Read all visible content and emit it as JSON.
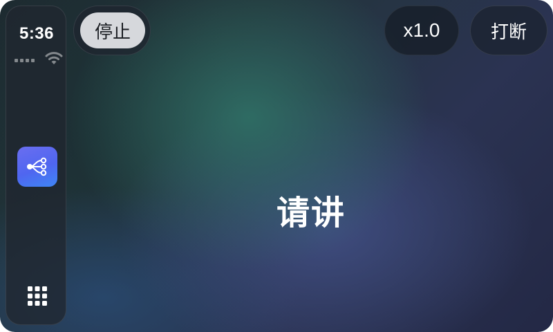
{
  "status_bar": {
    "time": "5:36",
    "signal_icon": "cellular-signal-icon",
    "wifi_icon": "wifi-icon"
  },
  "sidebar": {
    "app_icon": "share-nodes-icon",
    "app_icon_color": "#4f66f0",
    "launcher_icon": "app-grid-icon"
  },
  "toolbar": {
    "stop_label": "停止",
    "speed_label": "x1.0",
    "interrupt_label": "打断"
  },
  "main": {
    "prompt": "请讲"
  }
}
